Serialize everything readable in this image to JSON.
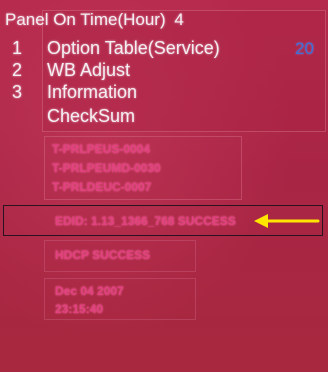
{
  "panel_on_time": {
    "label": "Panel On Time(Hour)",
    "value": "4"
  },
  "menu": [
    {
      "num": "1",
      "label": "Option Table(Service)",
      "value": "20"
    },
    {
      "num": "2",
      "label": "WB Adjust"
    },
    {
      "num": "3",
      "label": "Information"
    },
    {
      "num": "",
      "label": "CheckSum"
    }
  ],
  "info": {
    "versions": [
      "T-PRLPEUS-0004",
      "T-PRLPEUMD-0030",
      "T-PRLDEUC-0007"
    ],
    "edid": "EDID: 1.13_1366_768 SUCCESS",
    "hdcp": "HDCP SUCCESS",
    "date": "Dec 04 2007",
    "time": "23:15:40"
  },
  "colors": {
    "background": "#b0284a",
    "menu_text": "#f4eef2",
    "value_blue": "#3f6fd8",
    "info_text": "#e2407f",
    "annotation_arrow": "#ffe600"
  },
  "icons": {
    "annotation": "arrow-left-icon"
  }
}
